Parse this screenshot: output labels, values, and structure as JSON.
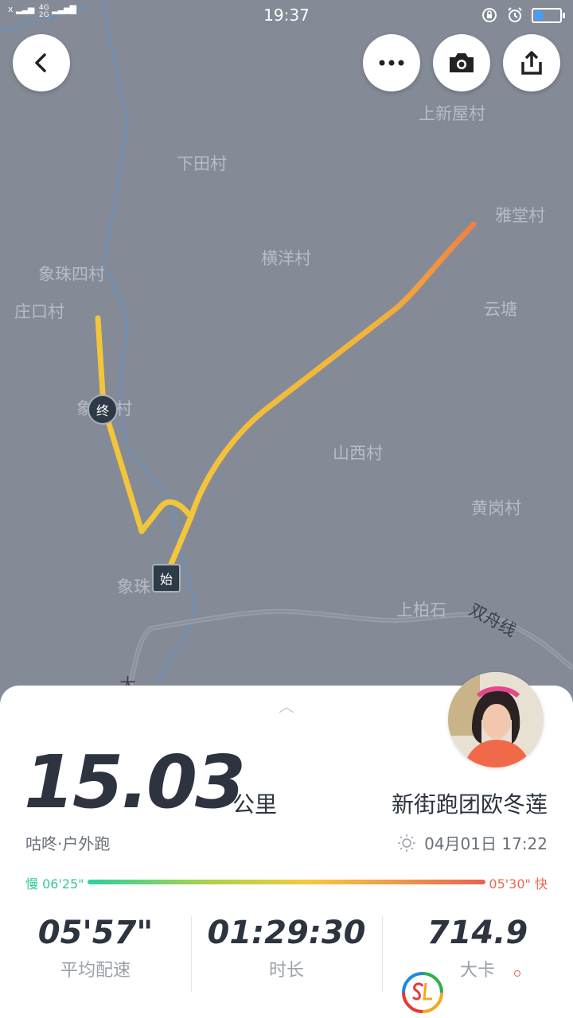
{
  "status_bar": {
    "time": "19:37",
    "signal_left": "x",
    "network_4g": "4G",
    "network_2g": "2G",
    "battery_fraction": 0.32,
    "icons": [
      "signal-icon",
      "lock-rotation-icon",
      "alarm-icon",
      "battery-icon"
    ]
  },
  "header": {
    "buttons": [
      "back-icon",
      "more-icon",
      "camera-icon",
      "share-icon"
    ]
  },
  "map": {
    "places": [
      "上新屋村",
      "下田村",
      "雅堂村",
      "横洋村",
      "象珠四村",
      "庄口村",
      "云塘",
      "象",
      "村",
      "山西村",
      "黄岗村",
      "象珠",
      "上柏石",
      "大"
    ],
    "road_name": "双舟线",
    "start_marker": "始",
    "end_marker": "终",
    "route_colors": {
      "slow": "#f5c93a",
      "fast": "#ef7f45"
    }
  },
  "summary": {
    "distance": "15.03",
    "distance_unit": "公里",
    "sport_type": "咕咚·户外跑",
    "user_name": "新街跑团欧冬莲",
    "datetime": "04月01日 17:22",
    "pace_slow_label": "慢 06'25\"",
    "pace_fast_label": "05'30\" 快",
    "stats": [
      {
        "value": "05'57\"",
        "label": "平均配速"
      },
      {
        "value": "01:29:30",
        "label": "时长"
      },
      {
        "value": "714.9",
        "label": "大卡"
      }
    ]
  },
  "colors": {
    "accent_green": "#33c79b",
    "accent_red": "#e8684f",
    "text_dark": "#2d3440"
  }
}
